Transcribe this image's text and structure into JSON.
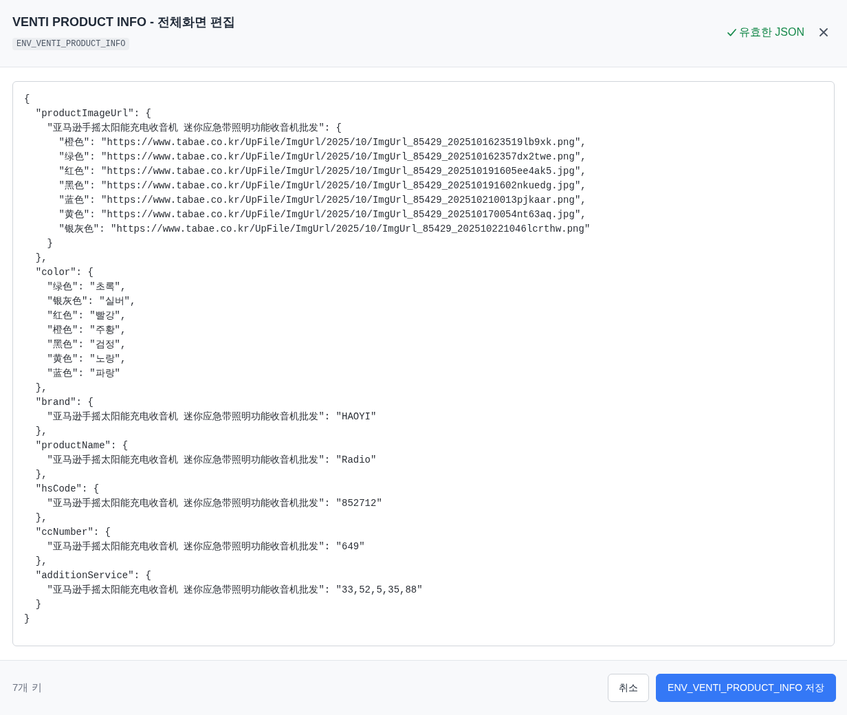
{
  "header": {
    "title": "VENTI PRODUCT INFO - 전체화면 편집",
    "env_key": "ENV_VENTI_PRODUCT_INFO"
  },
  "validation": {
    "valid": true,
    "label": "유효한 JSON"
  },
  "editor": {
    "lines": [
      "{",
      "  \"productImageUrl\": {",
      "    \"亚马逊手摇太阳能充电收音机 迷你应急带照明功能收音机批发\": {",
      "      \"橙色\": \"https://www.tabae.co.kr/UpFile/ImgUrl/2025/10/ImgUrl_85429_2025101623519lb9xk.png\",",
      "      \"绿色\": \"https://www.tabae.co.kr/UpFile/ImgUrl/2025/10/ImgUrl_85429_202510162357dx2twe.png\",",
      "      \"红色\": \"https://www.tabae.co.kr/UpFile/ImgUrl/2025/10/ImgUrl_85429_202510191605ee4ak5.jpg\",",
      "      \"黑色\": \"https://www.tabae.co.kr/UpFile/ImgUrl/2025/10/ImgUrl_85429_202510191602nkuedg.jpg\",",
      "      \"蓝色\": \"https://www.tabae.co.kr/UpFile/ImgUrl/2025/10/ImgUrl_85429_202510210013pjkaar.png\",",
      "      \"黄色\": \"https://www.tabae.co.kr/UpFile/ImgUrl/2025/10/ImgUrl_85429_202510170054nt63aq.jpg\",",
      "      \"银灰色\": \"https://www.tabae.co.kr/UpFile/ImgUrl/2025/10/ImgUrl_85429_202510221046lcrthw.png\"",
      "    }",
      "  },",
      "  \"color\": {",
      "    \"绿色\": \"초록\",",
      "    \"银灰色\": \"실버\",",
      "    \"红色\": \"빨강\",",
      "    \"橙色\": \"주황\",",
      "    \"黑色\": \"검정\",",
      "    \"黄色\": \"노랑\",",
      "    \"蓝色\": \"파랑\"",
      "  },",
      "  \"brand\": {",
      "    \"亚马逊手摇太阳能充电收音机 迷你应急带照明功能收音机批发\": \"HAOYI\"",
      "  },",
      "  \"productName\": {",
      "    \"亚马逊手摇太阳能充电收音机 迷你应急带照明功能收音机批发\": \"Radio\"",
      "  },",
      "  \"hsCode\": {",
      "    \"亚马逊手摇太阳能充电收音机 迷你应急带照明功能收音机批发\": \"852712\"",
      "  },",
      "  \"ccNumber\": {",
      "    \"亚马逊手摇太阳能充电收音机 迷你应急带照明功能收音机批发\": \"649\"",
      "  },",
      "  \"additionService\": {",
      "    \"亚马逊手摇太阳能充电收音机 迷你应急带照明功能收音机批发\": \"33,52,5,35,88\"",
      "  }",
      "}"
    ]
  },
  "footer": {
    "key_count": "7개 키",
    "buttons": [
      {
        "kind": "secondary",
        "label": "취소"
      },
      {
        "kind": "primary",
        "label": "ENV_VENTI_PRODUCT_INFO 저장"
      }
    ]
  }
}
